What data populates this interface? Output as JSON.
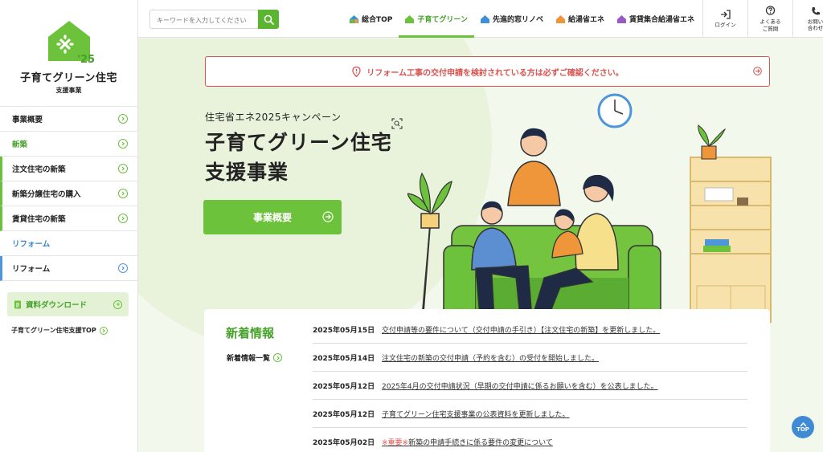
{
  "site": {
    "logo_year": "'25",
    "logo_title": "子育てグリーン住宅",
    "logo_sub": "支援事業"
  },
  "sidebar": {
    "items": [
      {
        "label": "事業概要"
      },
      {
        "label": "新築"
      },
      {
        "label": "注文住宅の新築"
      },
      {
        "label": "新築分譲住宅の購入"
      },
      {
        "label": "賃貸住宅の新築"
      },
      {
        "label": "リフォーム"
      },
      {
        "label": "リフォーム"
      }
    ],
    "download_label": "資料ダウンロード",
    "top_link": "子育てグリーン住宅支援TOP"
  },
  "header": {
    "search_placeholder": "キーワードを入力してください",
    "nav": [
      {
        "label": "総合TOP"
      },
      {
        "label": "子育てグリーン"
      },
      {
        "label": "先進的窓リノベ"
      },
      {
        "label": "給湯省エネ"
      },
      {
        "label": "賃貸集合給湯省エネ"
      }
    ],
    "buttons": {
      "login": "ログイン",
      "faq_1": "よくある",
      "faq_2": "ご質問",
      "contact_1": "お問い",
      "contact_2": "合わせ"
    }
  },
  "notice": "リフォーム工事の交付申請を検討されている方は必ずご確認ください。",
  "hero": {
    "sub": "住宅省エネ2025キャンペーン",
    "title_1": "子育てグリーン住宅",
    "title_2": "支援事業",
    "button": "事業概要"
  },
  "news": {
    "heading": "新着情報",
    "all_link": "新着情報一覧",
    "items": [
      {
        "date": "2025年05月15日",
        "text": "交付申請等の要件について（交付申請の手引き）【注文住宅の新築】を更新しました。"
      },
      {
        "date": "2025年05月14日",
        "text": "注文住宅の新築の交付申請（予約を含む）の受付を開始しました。"
      },
      {
        "date": "2025年05月12日",
        "text": "2025年4月の交付申請状況（早期の交付申請に係るお願いを含む）を公表しました。"
      },
      {
        "date": "2025年05月12日",
        "text": "子育てグリーン住宅支援事業の公表資料を更新しました。"
      },
      {
        "date": "2025年05月02日",
        "important": "※重要※",
        "text": "新築の申請手続きに係る要件の変更について"
      }
    ]
  },
  "to_top": "TOP",
  "colors": {
    "brand_green": "#6cc23a",
    "brand_green_dark": "#46a12a",
    "accent_blue": "#3f8ad4",
    "alert_red": "#d9534f"
  }
}
